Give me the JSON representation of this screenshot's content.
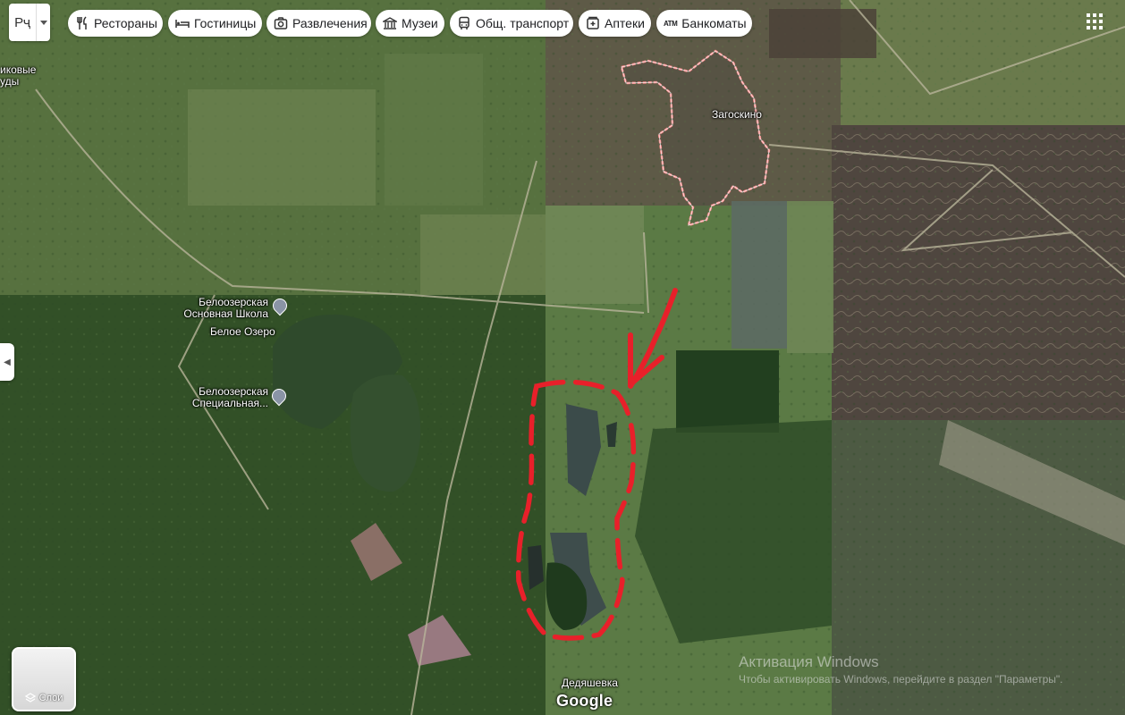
{
  "search": {
    "value": "Рҷ"
  },
  "chips": [
    {
      "label": "Рестораны",
      "icon": "fork-knife-icon"
    },
    {
      "label": "Гостиницы",
      "icon": "bed-icon"
    },
    {
      "label": "Развлечения",
      "icon": "camera-icon"
    },
    {
      "label": "Музеи",
      "icon": "museum-icon"
    },
    {
      "label": "Общ. транспорт",
      "icon": "bus-icon"
    },
    {
      "label": "Аптеки",
      "icon": "pharmacy-icon"
    },
    {
      "label": "Банкоматы",
      "icon": "atm-icon",
      "icon_text": "ATM"
    }
  ],
  "layers": {
    "label": "Слои"
  },
  "places": {
    "zagoskino": "Загоскино",
    "school_line1": "Белоозерская",
    "school_line2": "Основная Школа",
    "lake": "Белое Озеро",
    "special_line1": "Белоозерская",
    "special_line2": "Специальная...",
    "dedyashevka": "Дедяшевка",
    "edge_line1": "иковые",
    "edge_line2": "уды"
  },
  "logo": "Google",
  "watermark": {
    "title": "Активация Windows",
    "subtitle": "Чтобы активировать Windows, перейдите в раздел \"Параметры\"."
  },
  "colors": {
    "annotation": "#e8202a",
    "boundary": "#f08080",
    "lake": "#2f4a2c"
  }
}
